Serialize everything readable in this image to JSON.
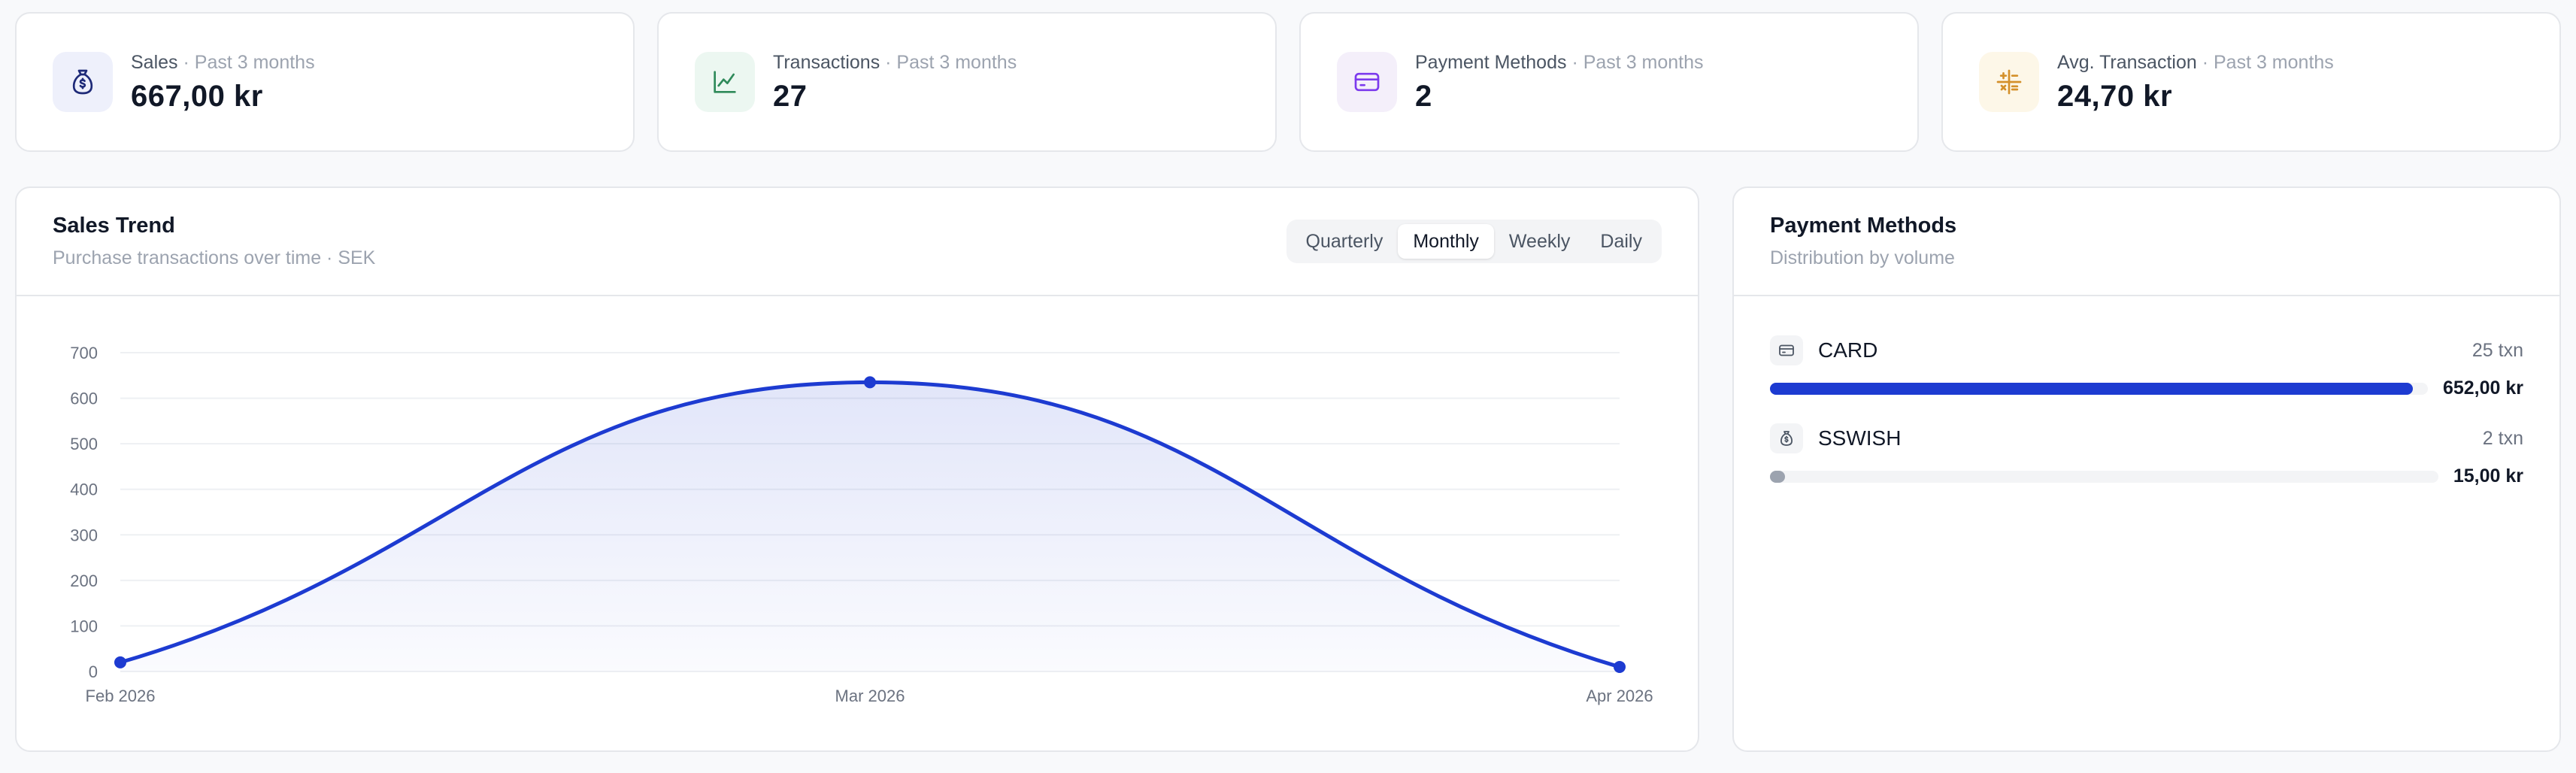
{
  "stats": [
    {
      "label": "Sales",
      "period": "· Past 3 months",
      "value": "667,00 kr",
      "icon": "money-bag-icon",
      "icon_bg": "#eef0fb",
      "icon_color": "#1e2a78"
    },
    {
      "label": "Transactions",
      "period": "· Past 3 months",
      "value": "27",
      "icon": "line-chart-icon",
      "icon_bg": "#ecf7f1",
      "icon_color": "#2f8a5a"
    },
    {
      "label": "Payment Methods",
      "period": "· Past 3 months",
      "value": "2",
      "icon": "credit-card-icon",
      "icon_bg": "#f4effa",
      "icon_color": "#7c3aed"
    },
    {
      "label": "Avg. Transaction",
      "period": "· Past 3 months",
      "value": "24,70 kr",
      "icon": "calculator-icon",
      "icon_bg": "#fdf7e8",
      "icon_color": "#d4902a"
    }
  ],
  "trend": {
    "title": "Sales Trend",
    "subtitle": "Purchase transactions over time · SEK",
    "periods": [
      "Quarterly",
      "Monthly",
      "Weekly",
      "Daily"
    ],
    "active_period": "Monthly"
  },
  "chart_data": {
    "type": "area",
    "x": [
      "Feb 2026",
      "Mar 2026",
      "Apr 2026"
    ],
    "series": [
      {
        "values": [
          20,
          635,
          10
        ]
      }
    ],
    "yticks": [
      0,
      100,
      200,
      300,
      400,
      500,
      600,
      700
    ],
    "ylim": [
      0,
      700
    ],
    "grid": true,
    "line_color": "#1d3bd1"
  },
  "payment_methods": {
    "title": "Payment Methods",
    "subtitle": "Distribution by volume",
    "items": [
      {
        "name": "CARD",
        "txn": "25 txn",
        "amount": "652,00 kr",
        "share": 0.9775,
        "icon": "credit-card-icon",
        "bar_color": "#1d3bd1"
      },
      {
        "name": "SSWISH",
        "txn": "2 txn",
        "amount": "15,00 kr",
        "share": 0.0225,
        "icon": "money-bag-icon",
        "bar_color": "#9ca3af"
      }
    ]
  }
}
